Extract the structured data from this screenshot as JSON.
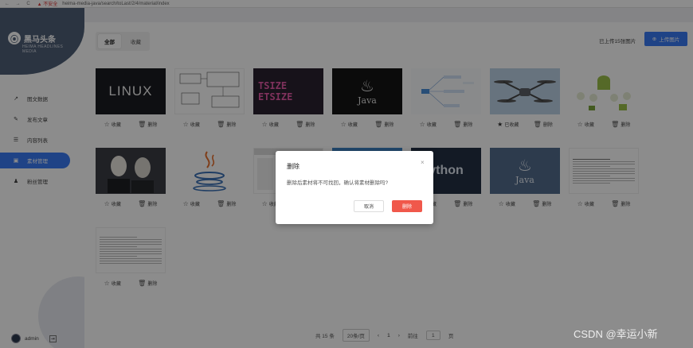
{
  "browser": {
    "nav": "← → C",
    "warning": "▲ 不安全",
    "url": "heima-media-java/search/toLast/2/4/material/index"
  },
  "brand": {
    "name": "黑马头条",
    "sub": "HEIMA HEADLINES MEDIA",
    "mark": "⦿"
  },
  "sidebar": {
    "items": [
      {
        "label": "图文数据",
        "icon": "↗"
      },
      {
        "label": "发布文章",
        "icon": "✎"
      },
      {
        "label": "内容列表",
        "icon": "☰"
      },
      {
        "label": "素材管理",
        "icon": "▣"
      },
      {
        "label": "粉丝管理",
        "icon": "♟"
      }
    ],
    "active_index": 3
  },
  "user": {
    "name": "admin",
    "logout_icon": "⇥"
  },
  "tabs": [
    {
      "label": "全部"
    },
    {
      "label": "收藏"
    }
  ],
  "uploaded_count": "已上传15张图片",
  "upload_button": {
    "label": "上传图片",
    "icon": "⊕"
  },
  "cards": [
    {
      "thumb": "linux",
      "text": "LINUX",
      "favorite": "收藏",
      "delete": "删除",
      "starred": false
    },
    {
      "thumb": "uml",
      "text": "",
      "favorite": "收藏",
      "delete": "删除",
      "starred": false
    },
    {
      "thumb": "code",
      "text": "TSIZE\nETSIZE",
      "favorite": "收藏",
      "delete": "删除",
      "starred": false
    },
    {
      "thumb": "java-black",
      "text": "Java",
      "favorite": "收藏",
      "delete": "删除",
      "starred": false
    },
    {
      "thumb": "mindmap",
      "text": "",
      "favorite": "收藏",
      "delete": "删除",
      "starred": false
    },
    {
      "thumb": "drone",
      "text": "",
      "favorite": "已收藏",
      "delete": "删除",
      "starred": true
    },
    {
      "thumb": "android",
      "text": "",
      "favorite": "收藏",
      "delete": "删除",
      "starred": false
    },
    {
      "thumb": "people",
      "text": "",
      "favorite": "收藏",
      "delete": "删除",
      "starred": false
    },
    {
      "thumb": "java-cup",
      "text": "",
      "favorite": "收藏",
      "delete": "删除",
      "starred": false
    },
    {
      "thumb": "screenshot",
      "text": "",
      "favorite": "收藏",
      "delete": "删除",
      "starred": false
    },
    {
      "thumb": "blue",
      "text": "",
      "favorite": "收藏",
      "delete": "删除",
      "starred": false
    },
    {
      "thumb": "python",
      "text": "ython",
      "favorite": "收藏",
      "delete": "删除",
      "starred": false
    },
    {
      "thumb": "java-blue",
      "text": "Java",
      "favorite": "收藏",
      "delete": "删除",
      "starred": false
    },
    {
      "thumb": "doc",
      "text": "",
      "favorite": "收藏",
      "delete": "删除",
      "starred": false
    },
    {
      "thumb": "doc-tall",
      "text": "",
      "favorite": "收藏",
      "delete": "删除",
      "starred": false
    }
  ],
  "pagination": {
    "total": "共 15 条",
    "page_size": "20条/页",
    "prev": "‹",
    "current": "1",
    "next": "›",
    "jump_label": "前往",
    "jump_value": "1",
    "jump_suffix": "页"
  },
  "dialog": {
    "title": "删除",
    "close": "×",
    "message": "删除后素材将不可找回，确认将素材删除吗?",
    "cancel": "取消",
    "confirm": "删除"
  },
  "watermark": "CSDN @幸运小新",
  "colors": {
    "primary": "#3a7bf5",
    "danger": "#f0584b",
    "sidebar_top": "#4f5f77"
  }
}
